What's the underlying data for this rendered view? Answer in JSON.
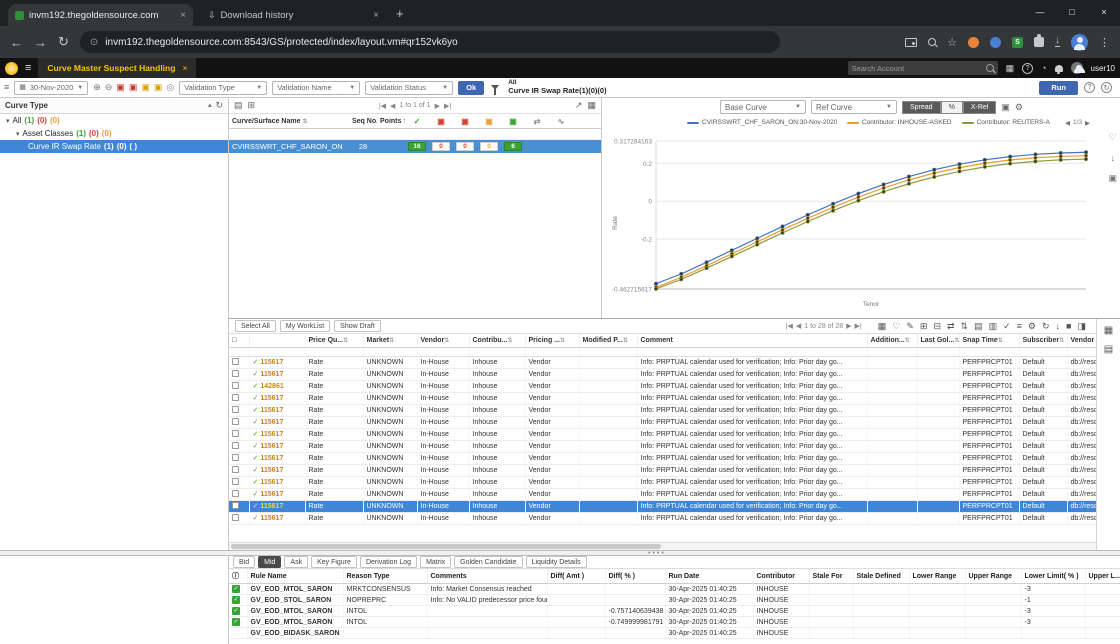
{
  "browser": {
    "tab_site": "invm192.thegoldensource.com",
    "tab_downloads": "Download history",
    "url": "invm192.thegoldensource.com:8543/GS/protected/index/layout.vm#qr152vk6yo"
  },
  "appbar": {
    "tab": "Curve Master Suspect Handling",
    "search_placeholder": "Search Account",
    "user": "user10"
  },
  "toolbar": {
    "date": "30-Nov-2020",
    "icons": [
      {
        "name": "zoom-in-icon",
        "glyph": "⊕",
        "color": "#777777"
      },
      {
        "name": "zoom-out-icon",
        "glyph": "⊖",
        "color": "#777777"
      },
      {
        "name": "red-layer-icon",
        "glyph": "▣",
        "color": "#c0392b"
      },
      {
        "name": "red-grid-icon",
        "glyph": "▣",
        "color": "#c0392b"
      },
      {
        "name": "yellow-layer-icon",
        "glyph": "▣",
        "color": "#d8a200"
      },
      {
        "name": "yellow-grid-icon",
        "glyph": "▣",
        "color": "#d8a200"
      },
      {
        "name": "target-icon",
        "glyph": "◎",
        "color": "#888888"
      }
    ],
    "validation_type": "Validation Type",
    "validation_name": "Validation Name",
    "validation_status": "Validation Status",
    "ok": "Ok",
    "scope_title": "All",
    "scope_sub": "Curve IR Swap Rate(1)(0)(0)",
    "run": "Run"
  },
  "sidebar": {
    "title": "Curve Type",
    "items": [
      {
        "name": "All",
        "c1": "(1)",
        "c2": "(0)",
        "c3": "(0)"
      },
      {
        "name": "Asset Classes",
        "c1": "(1)",
        "c2": "(0)",
        "c3": "(0)"
      },
      {
        "name": "Curve IR Swap Rate",
        "c1": "(1)",
        "c2": "(0)",
        "c3": "( )"
      }
    ]
  },
  "curvegrid": {
    "pagination": "1 to 1 of 1",
    "headers": {
      "name": "Curve/Surface Name",
      "seq": "Seq No.",
      "points": "Points"
    },
    "icon_headers": [
      {
        "name": "valid-count-icon",
        "glyph": "✓",
        "color": "#3aa335"
      },
      {
        "name": "error-count-icon",
        "glyph": "▣",
        "color": "#d04437"
      },
      {
        "name": "rejected-count-icon",
        "glyph": "▣",
        "color": "#d04437"
      },
      {
        "name": "warning-count-icon",
        "glyph": "▣",
        "color": "#e8a33d"
      },
      {
        "name": "approved-count-icon",
        "glyph": "▣",
        "color": "#3aa335"
      },
      {
        "name": "compare-icon",
        "glyph": "⇄",
        "color": "#888888"
      },
      {
        "name": "curve-icon",
        "glyph": "∿",
        "color": "#888888"
      }
    ],
    "row": {
      "name": "CVIRSSWRT_CHF_SARON_ON",
      "seq": "28",
      "badges": [
        {
          "v": "16",
          "bg": "#3aa335",
          "fg": "#ffffff"
        },
        {
          "v": "0",
          "bg": "#ffffff",
          "fg": "#d04437"
        },
        {
          "v": "0",
          "bg": "#ffffff",
          "fg": "#d04437"
        },
        {
          "v": "0",
          "bg": "#ffffff",
          "fg": "#e8a33d"
        },
        {
          "v": "6",
          "bg": "#3aa335",
          "fg": "#ffffff"
        }
      ]
    }
  },
  "chartpanel": {
    "base_curve": "Base Curve",
    "ref_curve": "Ref Curve",
    "modes": [
      {
        "label": "Spread",
        "active": true
      },
      {
        "label": "%",
        "active": false
      },
      {
        "label": "X-Rel",
        "active": true
      }
    ],
    "legend_page": "1/3",
    "legend": [
      {
        "label": "CVIRSSWRT_CHF_SARON_ON:30-Nov-2020",
        "color": "#4472c4"
      },
      {
        "label": "Contributor: INHOUSE-ASKED",
        "color": "#ed9b33"
      },
      {
        "label": "Contributor: REUTERS-A",
        "color": "#8f9a3a"
      }
    ]
  },
  "chart_data": {
    "type": "line",
    "title": "",
    "xlabel": "Tenor",
    "ylabel": "Rate",
    "ylim": [
      -0.462715617,
      0.317284163
    ],
    "yticks": [
      {
        "v": 0.317284163,
        "label": "0.317284163"
      },
      {
        "v": 0.2,
        "label": "0.2"
      },
      {
        "v": 0,
        "label": "0"
      },
      {
        "v": -0.2,
        "label": "-0.2"
      },
      {
        "v": -0.462715617,
        "label": "-0.462715617"
      }
    ],
    "x": [
      1,
      2,
      3,
      4,
      5,
      6,
      7,
      8,
      9,
      10,
      11,
      12,
      13,
      14,
      15,
      16,
      17,
      18
    ],
    "series": [
      {
        "name": "CVIRSSWRT_CHF_SARON_ON:30-Nov-2020",
        "color": "#4472c4",
        "values": [
          -0.435,
          -0.383,
          -0.322,
          -0.259,
          -0.196,
          -0.133,
          -0.072,
          -0.014,
          0.04,
          0.088,
          0.13,
          0.166,
          0.195,
          0.218,
          0.235,
          0.247,
          0.254,
          0.258
        ]
      },
      {
        "name": "Contributor: INHOUSE-ASKED",
        "color": "#ed9b33",
        "values": [
          -0.453,
          -0.401,
          -0.34,
          -0.277,
          -0.214,
          -0.151,
          -0.09,
          -0.032,
          0.022,
          0.07,
          0.112,
          0.148,
          0.177,
          0.2,
          0.217,
          0.229,
          0.236,
          0.24
        ]
      },
      {
        "name": "Contributor: REUTERS-A",
        "color": "#8f9a3a",
        "values": [
          -0.462,
          -0.412,
          -0.353,
          -0.291,
          -0.229,
          -0.167,
          -0.107,
          -0.05,
          0.003,
          0.05,
          0.092,
          0.128,
          0.157,
          0.181,
          0.198,
          0.21,
          0.218,
          0.222
        ]
      }
    ]
  },
  "grid": {
    "tabs": [
      "Select All",
      "My WorkList",
      "Show Draft"
    ],
    "pagination": "1 to 28 of 28",
    "toolbar_icons": [
      {
        "name": "view-grid-icon",
        "glyph": "▦"
      },
      {
        "name": "favorite-icon",
        "glyph": "♡"
      },
      {
        "name": "edit-icon",
        "glyph": "✎"
      },
      {
        "name": "add-row-icon",
        "glyph": "⊞"
      },
      {
        "name": "remove-row-icon",
        "glyph": "⊟"
      },
      {
        "name": "swap-icon",
        "glyph": "⇄"
      },
      {
        "name": "sort-icon",
        "glyph": "⇅"
      },
      {
        "name": "rows-icon",
        "glyph": "▤"
      },
      {
        "name": "columns-icon",
        "glyph": "▥"
      },
      {
        "name": "validate-icon",
        "glyph": "✓"
      },
      {
        "name": "menu-icon",
        "glyph": "≡"
      },
      {
        "name": "settings-icon",
        "glyph": "⚙"
      },
      {
        "name": "refresh-icon",
        "glyph": "↻"
      },
      {
        "name": "download-icon",
        "glyph": "↓"
      },
      {
        "name": "stop-icon",
        "glyph": "■"
      },
      {
        "name": "panel-icon",
        "glyph": "◨"
      }
    ],
    "columns": [
      {
        "label": "□",
        "nosort": true
      },
      {
        "label": "",
        "nosort": true
      },
      {
        "label": "Price Qu...",
        "nosort": false
      },
      {
        "label": "Market",
        "nosort": false
      },
      {
        "label": "Vendor",
        "nosort": false
      },
      {
        "label": "Contribu...",
        "nosort": false
      },
      {
        "label": "Pricing ...",
        "nosort": false
      },
      {
        "label": "Modified P...",
        "nosort": false
      },
      {
        "label": "Comment",
        "nosort": true
      },
      {
        "label": "Addition...",
        "nosort": false
      },
      {
        "label": "Last Gol...",
        "nosort": false
      },
      {
        "label": "Snap Time",
        "nosort": false
      },
      {
        "label": "Subscriber",
        "nosort": false
      },
      {
        "label": "Vendor R...",
        "nosort": true
      }
    ],
    "rows": [
      {
        "id": "115617",
        "price": "Rate",
        "market": "UNKNOWN",
        "vendor": "In-House",
        "contrib": "Inhouse",
        "pricing": "Vendor",
        "modified": "",
        "comment": "Info: PRPTUAL calendar used for verification; Info: Prior day go...",
        "addition": "",
        "lastgol": "",
        "snap": "PERFPRCPT01",
        "subscriber": "Default",
        "vendor_r": "db://resc...",
        "selected": false
      },
      {
        "id": "115617",
        "price": "Rate",
        "market": "UNKNOWN",
        "vendor": "In-House",
        "contrib": "Inhouse",
        "pricing": "Vendor",
        "modified": "",
        "comment": "Info: PRPTUAL calendar used for verification; Info: Prior day go...",
        "addition": "",
        "lastgol": "",
        "snap": "PERFPRCPT01",
        "subscriber": "Default",
        "vendor_r": "db://resc...",
        "selected": false
      },
      {
        "id": "142861",
        "price": "Rate",
        "market": "UNKNOWN",
        "vendor": "In-House",
        "contrib": "Inhouse",
        "pricing": "Vendor",
        "modified": "",
        "comment": "Info: PRPTUAL calendar used for verification; Info: Prior day go...",
        "addition": "",
        "lastgol": "",
        "snap": "PERFPRCPT01",
        "subscriber": "Default",
        "vendor_r": "db://resc...",
        "selected": false
      },
      {
        "id": "115617",
        "price": "Rate",
        "market": "UNKNOWN",
        "vendor": "In-House",
        "contrib": "Inhouse",
        "pricing": "Vendor",
        "modified": "",
        "comment": "Info: PRPTUAL calendar used for verification; Info: Prior day go...",
        "addition": "",
        "lastgol": "",
        "snap": "PERFPRCPT01",
        "subscriber": "Default",
        "vendor_r": "db://resc...",
        "selected": false
      },
      {
        "id": "115617",
        "price": "Rate",
        "market": "UNKNOWN",
        "vendor": "In-House",
        "contrib": "Inhouse",
        "pricing": "Vendor",
        "modified": "",
        "comment": "Info: PRPTUAL calendar used for verification; Info: Prior day go...",
        "addition": "",
        "lastgol": "",
        "snap": "PERFPRCPT01",
        "subscriber": "Default",
        "vendor_r": "db://resc...",
        "selected": false
      },
      {
        "id": "115617",
        "price": "Rate",
        "market": "UNKNOWN",
        "vendor": "In-House",
        "contrib": "Inhouse",
        "pricing": "Vendor",
        "modified": "",
        "comment": "Info: PRPTUAL calendar used for verification; Info: Prior day go...",
        "addition": "",
        "lastgol": "",
        "snap": "PERFPRCPT01",
        "subscriber": "Default",
        "vendor_r": "db://resc...",
        "selected": false
      },
      {
        "id": "115617",
        "price": "Rate",
        "market": "UNKNOWN",
        "vendor": "In-House",
        "contrib": "Inhouse",
        "pricing": "Vendor",
        "modified": "",
        "comment": "Info: PRPTUAL calendar used for verification; Info: Prior day go...",
        "addition": "",
        "lastgol": "",
        "snap": "PERFPRCPT01",
        "subscriber": "Default",
        "vendor_r": "db://resc...",
        "selected": false
      },
      {
        "id": "115617",
        "price": "Rate",
        "market": "UNKNOWN",
        "vendor": "In-House",
        "contrib": "Inhouse",
        "pricing": "Vendor",
        "modified": "",
        "comment": "Info: PRPTUAL calendar used for verification; Info: Prior day go...",
        "addition": "",
        "lastgol": "",
        "snap": "PERFPRCPT01",
        "subscriber": "Default",
        "vendor_r": "db://resc...",
        "selected": false
      },
      {
        "id": "115617",
        "price": "Rate",
        "market": "UNKNOWN",
        "vendor": "In-House",
        "contrib": "Inhouse",
        "pricing": "Vendor",
        "modified": "",
        "comment": "Info: PRPTUAL calendar used for verification; Info: Prior day go...",
        "addition": "",
        "lastgol": "",
        "snap": "PERFPRCPT01",
        "subscriber": "Default",
        "vendor_r": "db://resc...",
        "selected": false
      },
      {
        "id": "115617",
        "price": "Rate",
        "market": "UNKNOWN",
        "vendor": "In-House",
        "contrib": "Inhouse",
        "pricing": "Vendor",
        "modified": "",
        "comment": "Info: PRPTUAL calendar used for verification; Info: Prior day go...",
        "addition": "",
        "lastgol": "",
        "snap": "PERFPRCPT01",
        "subscriber": "Default",
        "vendor_r": "db://resc...",
        "selected": false
      },
      {
        "id": "115617",
        "price": "Rate",
        "market": "UNKNOWN",
        "vendor": "In-House",
        "contrib": "Inhouse",
        "pricing": "Vendor",
        "modified": "",
        "comment": "Info: PRPTUAL calendar used for verification; Info: Prior day go...",
        "addition": "",
        "lastgol": "",
        "snap": "PERFPRCPT01",
        "subscriber": "Default",
        "vendor_r": "db://resc...",
        "selected": false
      },
      {
        "id": "115617",
        "price": "Rate",
        "market": "UNKNOWN",
        "vendor": "In-House",
        "contrib": "Inhouse",
        "pricing": "Vendor",
        "modified": "",
        "comment": "Info: PRPTUAL calendar used for verification; Info: Prior day go...",
        "addition": "",
        "lastgol": "",
        "snap": "PERFPRCPT01",
        "subscriber": "Default",
        "vendor_r": "db://resc...",
        "selected": false
      },
      {
        "id": "115617",
        "price": "Rate",
        "market": "UNKNOWN",
        "vendor": "In-House",
        "contrib": "Inhouse",
        "pricing": "Vendor",
        "modified": "",
        "comment": "Info: PRPTUAL calendar used for verification; Info: Prior day go...",
        "addition": "",
        "lastgol": "",
        "snap": "PERFPRCPT01",
        "subscriber": "Default",
        "vendor_r": "db://resc...",
        "selected": true
      },
      {
        "id": "115617",
        "price": "Rate",
        "market": "UNKNOWN",
        "vendor": "In-House",
        "contrib": "Inhouse",
        "pricing": "Vendor",
        "modified": "",
        "comment": "Info: PRPTUAL calendar used for verification; Info: Prior day go...",
        "addition": "",
        "lastgol": "",
        "snap": "PERFPRCPT01",
        "subscriber": "Default",
        "vendor_r": "db://resc...",
        "selected": false
      }
    ]
  },
  "bottom": {
    "tabs": [
      {
        "label": "Bid",
        "active": false
      },
      {
        "label": "Mid",
        "active": true
      },
      {
        "label": "Ask",
        "active": false
      },
      {
        "label": "Key Figure",
        "active": false
      },
      {
        "label": "Derivation Log",
        "active": false
      },
      {
        "label": "Matrix",
        "active": false
      },
      {
        "label": "Golden Candidate",
        "active": false
      },
      {
        "label": "Liquidity Details",
        "active": false
      }
    ],
    "columns": [
      "ⓘ",
      "Rule Name",
      "Reason Type",
      "Comments",
      "Diff( Amt )",
      "Diff( % )",
      "Run Date",
      "Contributor",
      "Stale For",
      "Stale Defined",
      "Lower Range",
      "Upper Range",
      "Lower Limit( % )",
      "Upper L..."
    ],
    "rows": [
      {
        "checked": true,
        "rule": "GV_EOD_MTOL_SARON",
        "reason": "MRKTCONSENSUS",
        "comments": "Info: Market Consensus reached",
        "diff_amt": "",
        "diff_pct": "",
        "run_date": "30-Apr-2025 01:40:25",
        "contributor": "INHOUSE",
        "stale_for": "",
        "stale_def": "",
        "lower_range": "",
        "upper_range": "",
        "lower_limit": "-3",
        "upper_l": ""
      },
      {
        "checked": true,
        "rule": "GV_EOD_STOL_SARON",
        "reason": "NOPREPRC",
        "comments": "Info: No VALID predecessor price found",
        "diff_amt": "",
        "diff_pct": "",
        "run_date": "30-Apr-2025 01:40:25",
        "contributor": "INHOUSE",
        "stale_for": "",
        "stale_def": "",
        "lower_range": "",
        "upper_range": "",
        "lower_limit": "-1",
        "upper_l": ""
      },
      {
        "checked": true,
        "rule": "GV_EOD_MTOL_SARON",
        "reason": "INTOL",
        "comments": "",
        "diff_amt": "",
        "diff_pct": "-0.757140639438",
        "run_date": "30-Apr-2025 01:40:25",
        "contributor": "INHOUSE",
        "stale_for": "",
        "stale_def": "",
        "lower_range": "",
        "upper_range": "",
        "lower_limit": "-3",
        "upper_l": ""
      },
      {
        "checked": true,
        "rule": "GV_EOD_MTOL_SARON",
        "reason": "INTOL",
        "comments": "",
        "diff_amt": "",
        "diff_pct": "-0.749999981791",
        "run_date": "30-Apr-2025 01:40:25",
        "contributor": "INHOUSE",
        "stale_for": "",
        "stale_def": "",
        "lower_range": "",
        "upper_range": "",
        "lower_limit": "-3",
        "upper_l": ""
      },
      {
        "checked": false,
        "rule": "GV_EOD_BIDASK_SARON",
        "reason": "",
        "comments": "",
        "diff_amt": "",
        "diff_pct": "",
        "run_date": "30-Apr-2025 01:40:25",
        "contributor": "INHOUSE",
        "stale_for": "",
        "stale_def": "",
        "lower_range": "",
        "upper_range": "",
        "lower_limit": "",
        "upper_l": ""
      }
    ]
  }
}
